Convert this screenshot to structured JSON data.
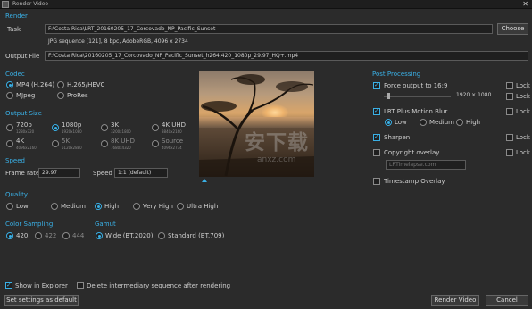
{
  "window": {
    "title": "Render Video",
    "close_glyph": "✕"
  },
  "render": {
    "section": "Render",
    "task_label": "Task",
    "task_value": "F:\\Costa Rica\\LRT_20160205_17_Corcovado_NP_Pacific_Sunset",
    "task_info": "JPG sequence [121], 8 bpc, AdobeRGB, 4096 x 2734",
    "choose_label": "Choose",
    "output_label": "Output File",
    "output_value": "F:\\Costa Rica\\20160205_17_Corcovado_NP_Pacific_Sunset_h264.420_1080p_29.97_HQ+.mp4"
  },
  "codec": {
    "section": "Codec",
    "options": [
      "MP4 (H.264)",
      "H.265/HEVC",
      "MJpeg",
      "ProRes"
    ],
    "selected": "MP4 (H.264)"
  },
  "output_size": {
    "section": "Output Size",
    "options": [
      {
        "label": "720p",
        "sub": "1280x720"
      },
      {
        "label": "1080p",
        "sub": "1920x1080"
      },
      {
        "label": "3K",
        "sub": "3200x1800"
      },
      {
        "label": "4K UHD",
        "sub": "3840x2160"
      },
      {
        "label": "4K",
        "sub": "4096x2160"
      },
      {
        "label": "5K",
        "sub": "5120x2880"
      },
      {
        "label": "8K UHD",
        "sub": "7680x4320"
      },
      {
        "label": "Source",
        "sub": "4096x2734"
      }
    ],
    "selected": "1080p"
  },
  "speed": {
    "section": "Speed",
    "framerate_label": "Frame rate",
    "framerate_value": "29.97",
    "speed_label": "Speed",
    "speed_value": "1:1 (default)"
  },
  "quality": {
    "section": "Quality",
    "options": [
      "Low",
      "Medium",
      "High",
      "Very High",
      "Ultra High"
    ],
    "selected": "High"
  },
  "color_sampling": {
    "section": "Color Sampling",
    "options": [
      "420",
      "422",
      "444"
    ],
    "selected": "420"
  },
  "gamut": {
    "section": "Gamut",
    "options": [
      "Wide (BT.2020)",
      "Standard (BT.709)"
    ],
    "selected": "Wide (BT.2020)"
  },
  "post": {
    "section": "Post Processing",
    "force_label": "Force output to 16:9",
    "force_checked": true,
    "force_lock": "Lock",
    "force_value": "1920 × 1080",
    "force_slider_fraction": 0.05,
    "blur_label": "LRT Plus Motion Blur",
    "blur_checked": true,
    "blur_lock": "Lock",
    "blur_options": [
      "Low",
      "Medium",
      "High"
    ],
    "blur_selected": "Low",
    "sharpen_label": "Sharpen",
    "sharpen_checked": true,
    "sharpen_lock": "Lock",
    "copyright_label": "Copyright overlay",
    "copyright_checked": false,
    "copyright_lock": "Lock",
    "copyright_placeholder": "LRTimelapse.com",
    "timestamp_label": "Timestamp Overlay",
    "timestamp_checked": false
  },
  "footer": {
    "show_explorer_label": "Show in Explorer",
    "show_explorer_checked": true,
    "delete_label": "Delete intermediary sequence after rendering",
    "delete_checked": false,
    "set_default_label": "Set settings as default",
    "render_label": "Render Video",
    "cancel_label": "Cancel"
  },
  "watermark": {
    "main": "安下载",
    "sub": "anxz.com"
  },
  "colors": {
    "accent": "#3ab0e6",
    "background": "#2b2b2b"
  }
}
